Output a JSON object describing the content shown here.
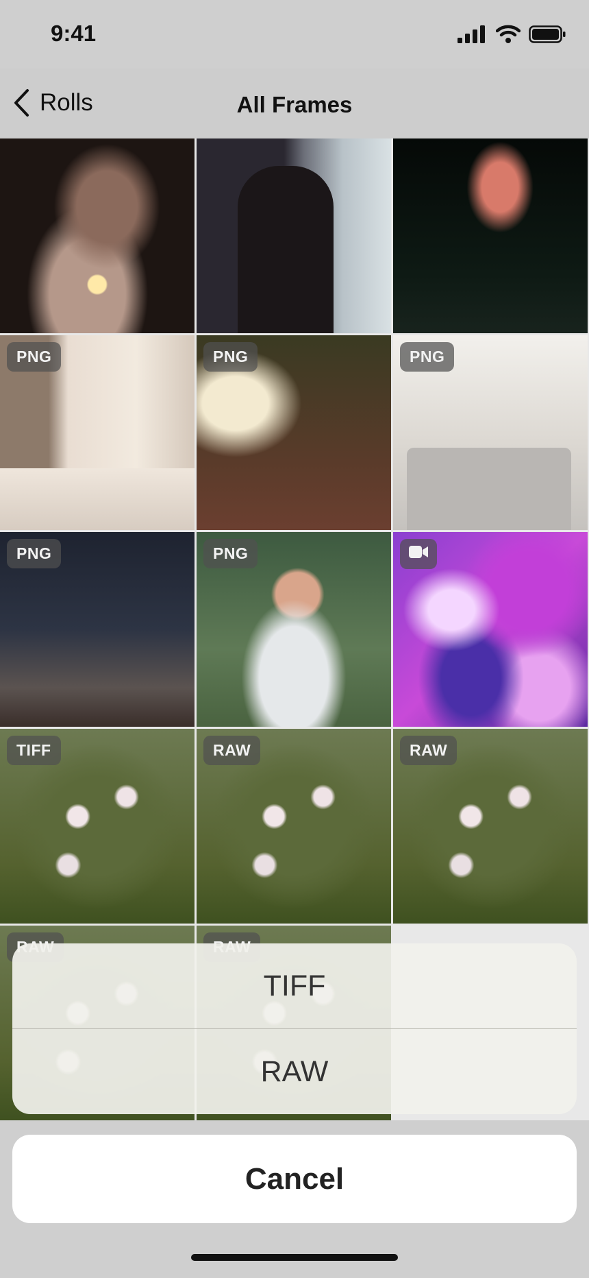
{
  "status_bar": {
    "time": "9:41"
  },
  "nav": {
    "back_label": "Rolls",
    "title": "All Frames"
  },
  "grid": {
    "tiles": [
      {
        "badge": ""
      },
      {
        "badge": ""
      },
      {
        "badge": ""
      },
      {
        "badge": "PNG"
      },
      {
        "badge": "PNG"
      },
      {
        "badge": "PNG"
      },
      {
        "badge": "PNG"
      },
      {
        "badge": "PNG"
      },
      {
        "badge": "video-camera-icon"
      },
      {
        "badge": "TIFF"
      },
      {
        "badge": "RAW"
      },
      {
        "badge": "RAW"
      },
      {
        "badge": "RAW"
      },
      {
        "badge": "RAW"
      }
    ]
  },
  "action_sheet": {
    "options": [
      "TIFF",
      "RAW"
    ],
    "cancel_label": "Cancel"
  }
}
